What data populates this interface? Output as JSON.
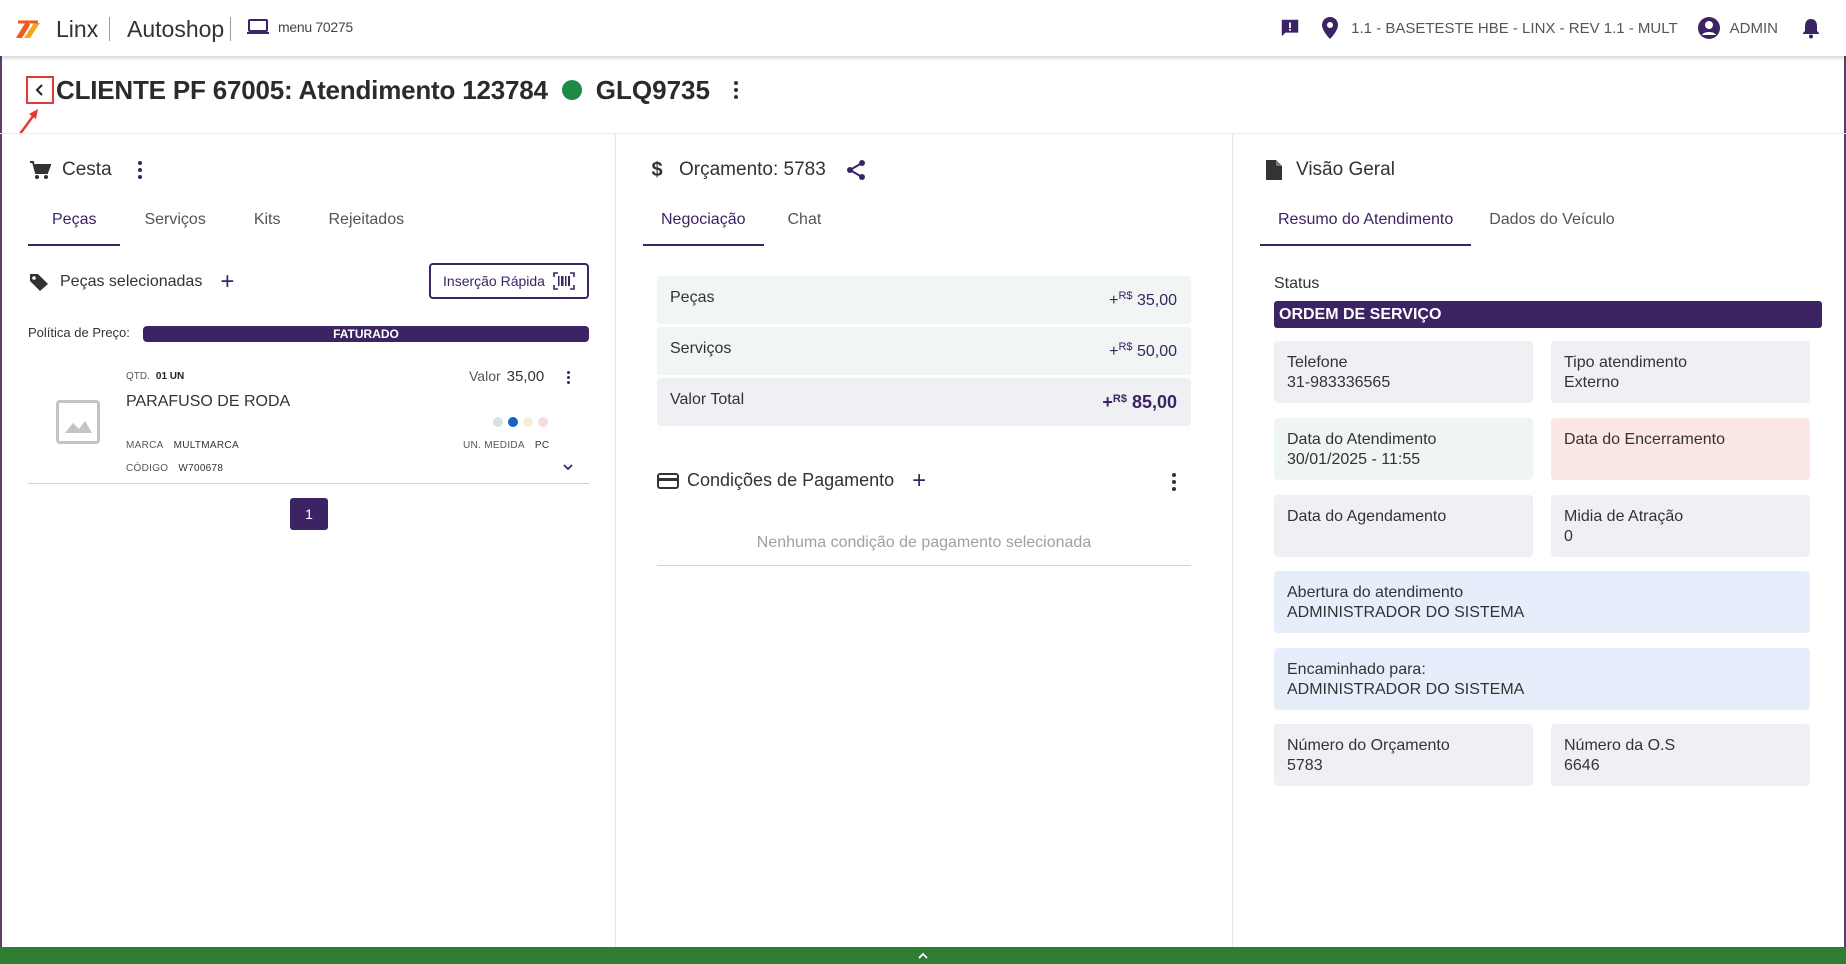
{
  "header": {
    "brand": "Linx",
    "product": "Autoshop",
    "menu_label": "menu 70275",
    "environment": "1.1 - BASETESTE HBE - LINX - REV 1.1 - MULT",
    "user": "ADMIN"
  },
  "title": {
    "text": "CLIENTE PF 67005: Atendimento 123784",
    "plate": "GLQ9735",
    "status_color": "#1e8a46"
  },
  "cesta": {
    "heading": "Cesta",
    "tabs": [
      {
        "label": "Peças",
        "active": true
      },
      {
        "label": "Serviços",
        "active": false
      },
      {
        "label": "Kits",
        "active": false
      },
      {
        "label": "Rejeitados",
        "active": false
      }
    ],
    "selected_label": "Peças selecionadas",
    "quick_insert_label": "Inserção Rápida",
    "price_policy_label": "Política de Preço:",
    "price_policy_value": "FATURADO",
    "item": {
      "qty_label": "QTD.",
      "qty_value": "01 UN",
      "name": "PARAFUSO DE RODA",
      "value_label": "Valor",
      "value": "35,00",
      "brand_label": "MARCA",
      "brand_value": "MULTMARCA",
      "code_label": "CÓDIGO",
      "code_value": "W700678",
      "unit_label": "UN. MEDIDA",
      "unit_value": "PC"
    },
    "page": "1"
  },
  "orcamento": {
    "heading": "Orçamento: 5783",
    "tabs": [
      {
        "label": "Negociação",
        "active": true
      },
      {
        "label": "Chat",
        "active": false
      }
    ],
    "rows": [
      {
        "label": "Peças",
        "prefix": "+",
        "currency": "R$",
        "value": "35,00"
      },
      {
        "label": "Serviços",
        "prefix": "+",
        "currency": "R$",
        "value": "50,00"
      },
      {
        "label": "Valor Total",
        "prefix": "+",
        "currency": "R$",
        "value": "85,00"
      }
    ],
    "payment_heading": "Condições de Pagamento",
    "payment_empty": "Nenhuma condição de pagamento selecionada"
  },
  "visao": {
    "heading": "Visão Geral",
    "tabs": [
      {
        "label": "Resumo do Atendimento",
        "active": true
      },
      {
        "label": "Dados do Veículo",
        "active": false
      }
    ],
    "status_label": "Status",
    "status_value": "ORDEM DE SERVIÇO",
    "cards": {
      "telefone": {
        "label": "Telefone",
        "value": "31-983336565"
      },
      "tipo": {
        "label": "Tipo atendimento",
        "value": "Externo"
      },
      "data_atendimento": {
        "label": "Data do Atendimento",
        "value": "30/01/2025 - 11:55"
      },
      "data_encerramento": {
        "label": "Data do Encerramento",
        "value": ""
      },
      "data_agendamento": {
        "label": "Data do Agendamento",
        "value": ""
      },
      "midia": {
        "label": "Midia de Atração",
        "value": "0"
      },
      "abertura": {
        "label": "Abertura do atendimento",
        "value": "ADMINISTRADOR DO SISTEMA"
      },
      "encaminhado": {
        "label": "Encaminhado para:",
        "value": "ADMINISTRADOR DO SISTEMA"
      },
      "num_orcamento": {
        "label": "Número do Orçamento",
        "value": "5783"
      },
      "num_os": {
        "label": "Número da O.S",
        "value": "6646"
      }
    }
  },
  "colors": {
    "accent": "#3c2364",
    "success": "#2e7d32",
    "annotation": "#e53935"
  }
}
